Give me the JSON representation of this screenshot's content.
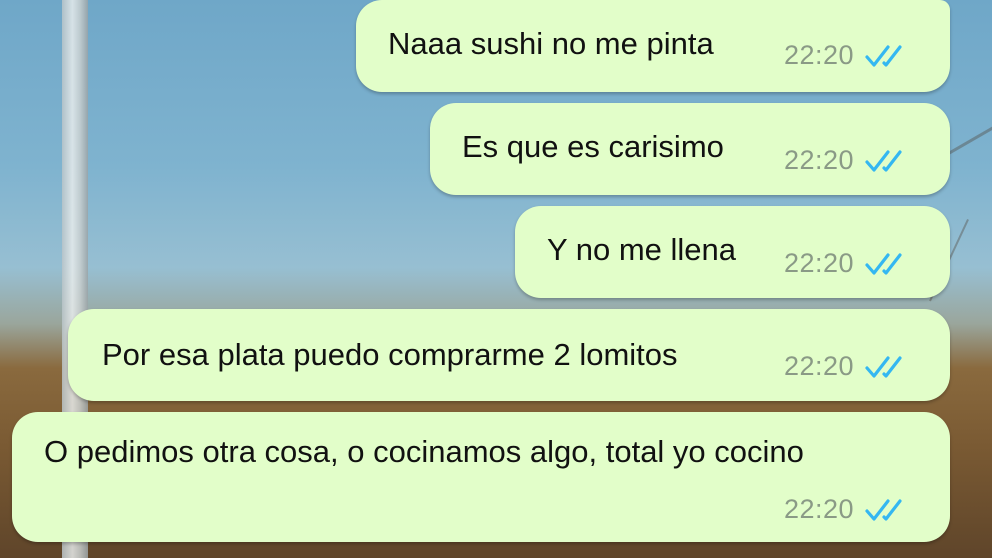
{
  "chat": {
    "messages": [
      {
        "text": "Naaa sushi no me pinta",
        "time": "22:20",
        "status": "read",
        "status_icon": "double-check-icon"
      },
      {
        "text": "Es que es carisimo",
        "time": "22:20",
        "status": "read",
        "status_icon": "double-check-icon"
      },
      {
        "text": "Y no me llena",
        "time": "22:20",
        "status": "read",
        "status_icon": "double-check-icon"
      },
      {
        "text": "Por esa plata puedo comprarme 2 lomitos",
        "time": "22:20",
        "status": "read",
        "status_icon": "double-check-icon"
      },
      {
        "text": "O pedimos otra cosa, o cocinamos algo, total yo cocino",
        "time": "22:20",
        "status": "read",
        "status_icon": "double-check-icon"
      }
    ]
  },
  "colors": {
    "bubble_outgoing": "#e2fec9",
    "read_tick": "#34b7f1",
    "timestamp": "#8a9a86"
  }
}
